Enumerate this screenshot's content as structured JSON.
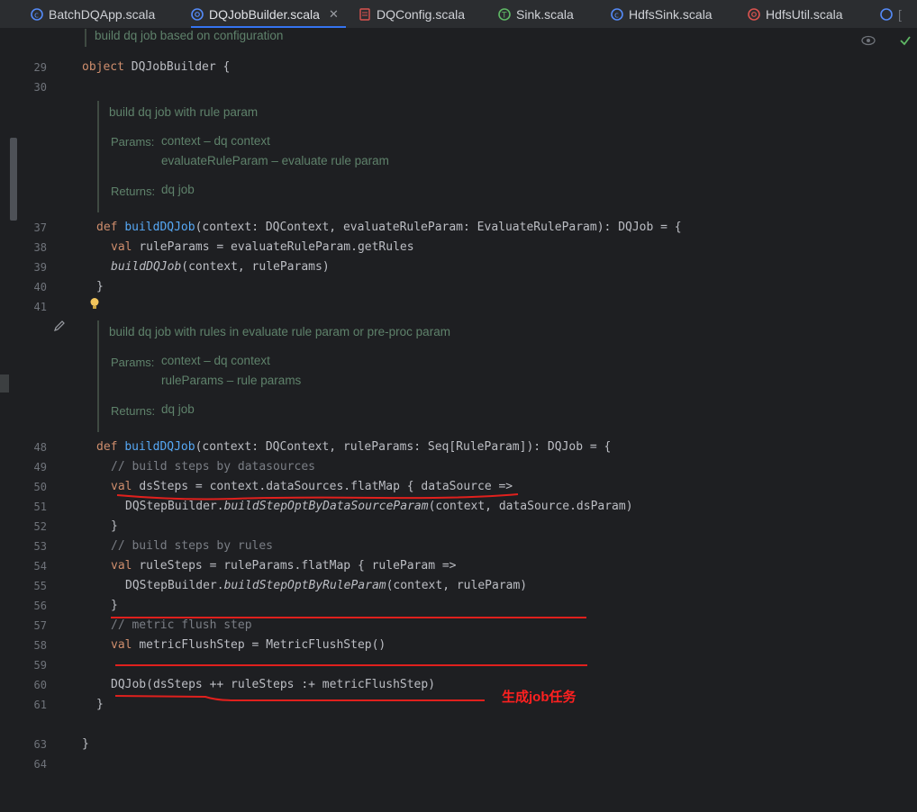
{
  "tabs": [
    {
      "label": "BatchDQApp.scala",
      "active": false
    },
    {
      "label": "DQJobBuilder.scala",
      "active": true
    },
    {
      "label": "DQConfig.scala",
      "active": false
    },
    {
      "label": "Sink.scala",
      "active": false
    },
    {
      "label": "HdfsSink.scala",
      "active": false
    },
    {
      "label": "HdfsUtil.scala",
      "active": false
    }
  ],
  "doc_header": "build dq job based on configuration",
  "lines": {
    "l29": "29",
    "l30": "30",
    "l37": "37",
    "l38": "38",
    "l39": "39",
    "l40": "40",
    "l41": "41",
    "l48": "48",
    "l49": "49",
    "l50": "50",
    "l51": "51",
    "l52": "52",
    "l53": "53",
    "l54": "54",
    "l55": "55",
    "l56": "56",
    "l57": "57",
    "l58": "58",
    "l59": "59",
    "l60": "60",
    "l61": "61",
    "l63": "63",
    "l64": "64"
  },
  "code": {
    "c29_kw": "object",
    "c29_rest": " DQJobBuilder {",
    "c37_kw": "def ",
    "c37_fn": "buildDQJob",
    "c37_rest": "(context: DQContext, evaluateRuleParam: EvaluateRuleParam): DQJob = {",
    "c38_kw": "val ",
    "c38_rest": "ruleParams = evaluateRuleParam.getRules",
    "c39_it": "buildDQJob",
    "c39_rest": "(context, ruleParams)",
    "c40": "}",
    "c48_kw": "def ",
    "c48_fn": "buildDQJob",
    "c48_rest": "(context: DQContext, ruleParams: Seq[RuleParam]): DQJob = {",
    "c49": "// build steps by datasources",
    "c50_kw": "val ",
    "c50_rest": "dsSteps = context.dataSources.flatMap { dataSource =>",
    "c51_a": "DQStepBuilder.",
    "c51_it": "buildStepOptByDataSourceParam",
    "c51_rest": "(context, dataSource.dsParam)",
    "c52": "}",
    "c53": "// build steps by rules",
    "c54_kw": "val ",
    "c54_rest": "ruleSteps = ruleParams.flatMap { ruleParam =>",
    "c55_a": "DQStepBuilder.",
    "c55_it": "buildStepOptByRuleParam",
    "c55_rest": "(context, ruleParam)",
    "c56": "}",
    "c57": "// metric flush step",
    "c58_kw": "val ",
    "c58_rest": "metricFlushStep = MetricFlushStep()",
    "c60": "DQJob(dsSteps ++ ruleSteps :+ metricFlushStep)",
    "c61": "}",
    "c63": "}"
  },
  "doc1": {
    "summary": "build dq job with rule param",
    "params_label": "Params:",
    "p1": "context – dq context",
    "p2": "evaluateRuleParam – evaluate rule param",
    "returns_label": "Returns:",
    "r": "dq job"
  },
  "doc2": {
    "summary": "build dq job with rules in evaluate rule param or pre-proc param",
    "params_label": "Params:",
    "p1": "context – dq context",
    "p2": "ruleParams – rule params",
    "returns_label": "Returns:",
    "r": "dq job"
  },
  "annotation": "生成job任务",
  "colors": {
    "accent": "#3574f0",
    "annotation": "#e0201d",
    "keyword": "#cf8e6d",
    "function": "#56a8f5",
    "doc": "#5f826b"
  },
  "icons": [
    "scala-class-icon",
    "scala-object-icon",
    "scala-trait-icon",
    "eye-icon",
    "check-icon",
    "pencil-icon",
    "bulb-icon"
  ]
}
